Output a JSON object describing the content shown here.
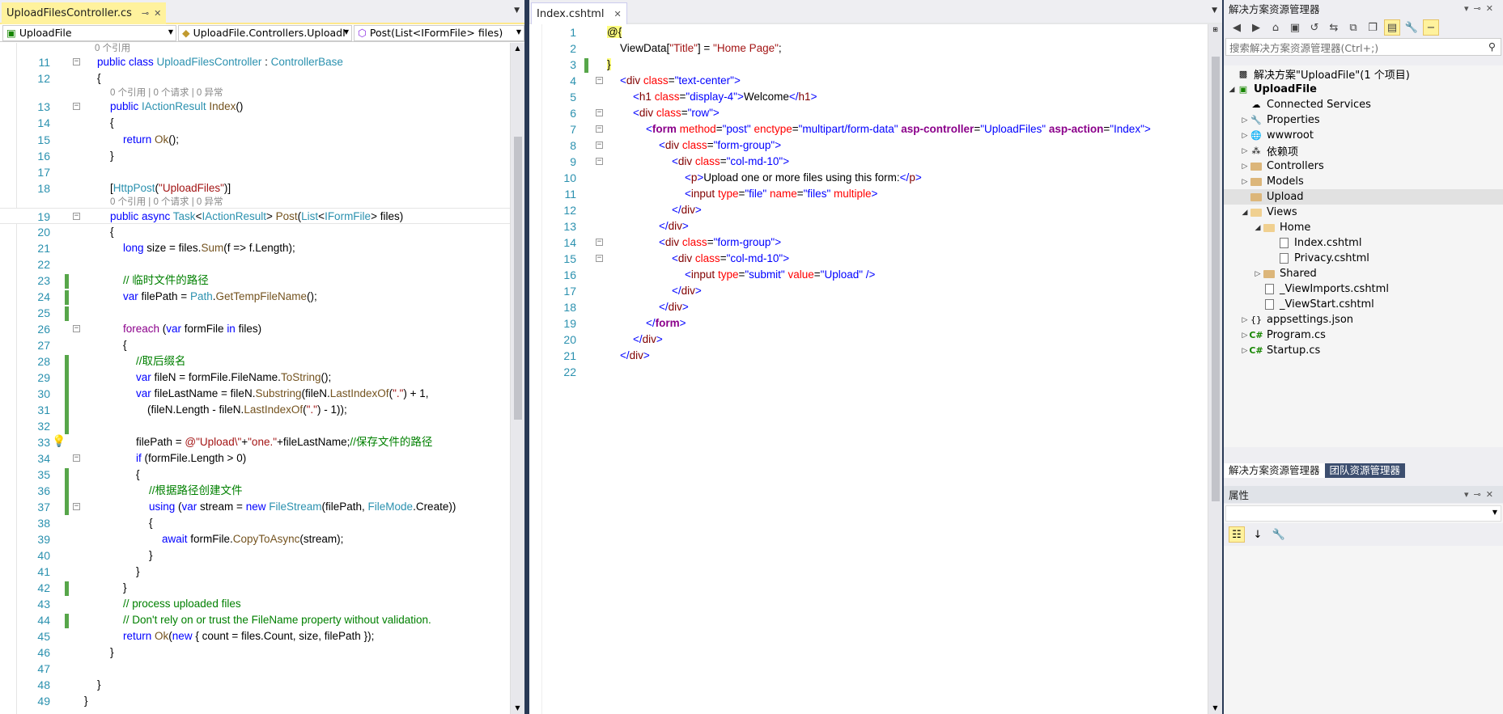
{
  "left_editor": {
    "tab": {
      "label": "UploadFilesController.cs"
    },
    "nav": {
      "project": "UploadFile",
      "type": "UploadFile.Controllers.UploadI",
      "member": "Post(List<IFormFile> files)"
    },
    "lens": {
      "refs0": "0 个引用",
      "refs_requests": "0 个引用 | 0 个请求 | 0 异常"
    },
    "lines": {
      "n11": "11",
      "n12": "12",
      "n13": "13",
      "n14": "14",
      "n15": "15",
      "n16": "16",
      "n17": "17",
      "n18": "18",
      "n19": "19",
      "n20": "20",
      "n21": "21",
      "n22": "22",
      "n23": "23",
      "n24": "24",
      "n25": "25",
      "n26": "26",
      "n27": "27",
      "n28": "28",
      "n29": "29",
      "n30": "30",
      "n31": "31",
      "n32": "32",
      "n33": "33",
      "n34": "34",
      "n35": "35",
      "n36": "36",
      "n37": "37",
      "n38": "38",
      "n39": "39",
      "n40": "40",
      "n41": "41",
      "n42": "42",
      "n43": "43",
      "n44": "44",
      "n45": "45",
      "n46": "46",
      "n47": "47",
      "n48": "48",
      "n49": "49"
    },
    "code": {
      "c23": "// 临时文件的路径",
      "c28": "//取后缀名",
      "c33_cm": "//保存文件的路径",
      "c36": "//根据路径创建文件",
      "c43": "// process uploaded files",
      "c44": "// Don't rely on or trust the FileName property without validation."
    }
  },
  "mid_editor": {
    "tab": {
      "label": "Index.cshtml"
    },
    "lines": {
      "n1": "1",
      "n2": "2",
      "n3": "3",
      "n4": "4",
      "n5": "5",
      "n6": "6",
      "n7": "7",
      "n8": "8",
      "n9": "9",
      "n10": "10",
      "n11": "11",
      "n12": "12",
      "n13": "13",
      "n14": "14",
      "n15": "15",
      "n16": "16",
      "n17": "17",
      "n18": "18",
      "n19": "19",
      "n20": "20",
      "n21": "21",
      "n22": "22"
    },
    "text": {
      "welcome": "Welcome",
      "upload_text": "Upload one or more files using this form:"
    }
  },
  "solution_explorer": {
    "title": "解决方案资源管理器",
    "search_placeholder": "搜索解决方案资源管理器(Ctrl+;)",
    "items": [
      {
        "label": "解决方案\"UploadFile\"(1 个项目)"
      },
      {
        "label": "UploadFile"
      },
      {
        "label": "Connected Services"
      },
      {
        "label": "Properties"
      },
      {
        "label": "wwwroot"
      },
      {
        "label": "依赖项"
      },
      {
        "label": "Controllers"
      },
      {
        "label": "Models"
      },
      {
        "label": "Upload"
      },
      {
        "label": "Views"
      },
      {
        "label": "Home"
      },
      {
        "label": "Index.cshtml"
      },
      {
        "label": "Privacy.cshtml"
      },
      {
        "label": "Shared"
      },
      {
        "label": "_ViewImports.cshtml"
      },
      {
        "label": "_ViewStart.cshtml"
      },
      {
        "label": "appsettings.json"
      },
      {
        "label": "Program.cs"
      },
      {
        "label": "Startup.cs"
      }
    ],
    "bottom_tabs": {
      "solution": "解决方案资源管理器",
      "team": "团队资源管理器"
    }
  },
  "properties": {
    "title": "属性"
  },
  "colors": {
    "accent_tab": "#fff29d",
    "frame": "#293955",
    "change_bar": "#57a64a"
  }
}
